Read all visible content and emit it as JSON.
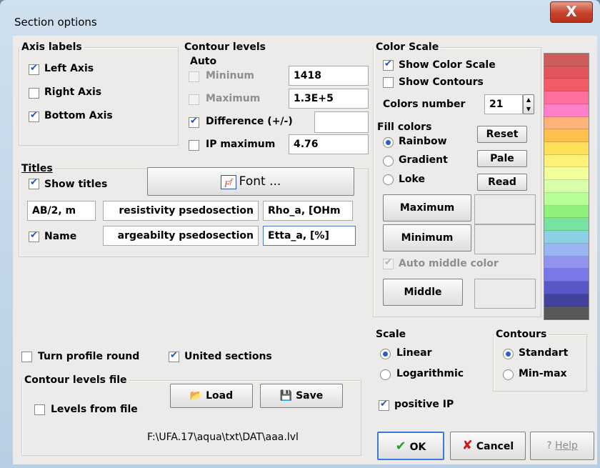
{
  "window": {
    "title": "Section options",
    "close_glyph": "X"
  },
  "axis_labels": {
    "legend": "Axis labels",
    "left": {
      "label": "Left Axis",
      "checked": true
    },
    "right": {
      "label": "Right Axis",
      "checked": false
    },
    "bottom": {
      "label": "Bottom Axis",
      "checked": true
    }
  },
  "contour_levels": {
    "legend": "Contour levels",
    "auto_label": "Auto",
    "minimum": {
      "label": "Mininum",
      "value": "1418",
      "checked": false
    },
    "maximum": {
      "label": "Maximum",
      "value": "1.3E+5",
      "checked": false
    },
    "difference": {
      "label": "Difference (+/-)",
      "value": "",
      "checked": true
    },
    "ip_max": {
      "label": "IP maximum",
      "value": "4.76",
      "checked": false
    }
  },
  "titles": {
    "legend": "Titles",
    "show_titles": {
      "label": "Show titles",
      "checked": true
    },
    "font_button": "Font ...",
    "row1": [
      "AB/2, m",
      "resistivity psedosection",
      "Rho_a, [OHm"
    ],
    "name": {
      "label": "Name",
      "checked": true
    },
    "row2": [
      "argeabilty psedosection",
      "Etta_a, [%]"
    ]
  },
  "options": {
    "turn_profile": {
      "label": "Turn profile round",
      "checked": false
    },
    "united_sections": {
      "label": "United sections",
      "checked": true
    }
  },
  "levels_file": {
    "legend": "Contour levels file",
    "from_file": {
      "label": "Levels from file",
      "checked": false
    },
    "load_button": "Load",
    "save_button": "Save",
    "path": "F:\\UFA.17\\aqua\\txt\\DAT\\aaa.lvl"
  },
  "color_scale": {
    "legend": "Color Scale",
    "show_scale": {
      "label": "Show Color Scale",
      "checked": true
    },
    "show_contours": {
      "label": "Show Contours",
      "checked": false
    },
    "colors_number_label": "Colors number",
    "colors_number": "21",
    "fill_legend": "Fill colors",
    "fill": [
      {
        "label": "Rainbow",
        "selected": true
      },
      {
        "label": "Gradient",
        "selected": false
      },
      {
        "label": "Loke",
        "selected": false
      }
    ],
    "reset_button": "Reset",
    "pale_button": "Pale",
    "read_button": "Read",
    "maximum_button": "Maximum",
    "minimum_button": "Minimum",
    "auto_middle": {
      "label": "Auto middle color",
      "checked": true
    },
    "middle_button": "Middle",
    "swatches": [
      "#cd5c5c",
      "#e0565c",
      "#f25a68",
      "#ff6f9a",
      "#ff80c8",
      "#ffb27a",
      "#ffc04c",
      "#ffe05a",
      "#fff07a",
      "#f3ff9a",
      "#d8ffaa",
      "#b8ff98",
      "#8ff07c",
      "#78e3a0",
      "#8ccfe7",
      "#9ab4f4",
      "#8f94ee",
      "#7a78e6",
      "#5858c7",
      "#43439e",
      "#585858"
    ]
  },
  "scale": {
    "legend": "Scale",
    "options": [
      {
        "label": "Linear",
        "selected": true
      },
      {
        "label": "Logarithmic",
        "selected": false
      }
    ]
  },
  "contours": {
    "legend": "Contours",
    "options": [
      {
        "label": "Standart",
        "selected": true
      },
      {
        "label": "Min-max",
        "selected": false
      }
    ]
  },
  "positive_ip": {
    "label": "positive IP",
    "checked": true
  },
  "buttons": {
    "ok": "OK",
    "cancel": "Cancel",
    "help": "Help"
  }
}
